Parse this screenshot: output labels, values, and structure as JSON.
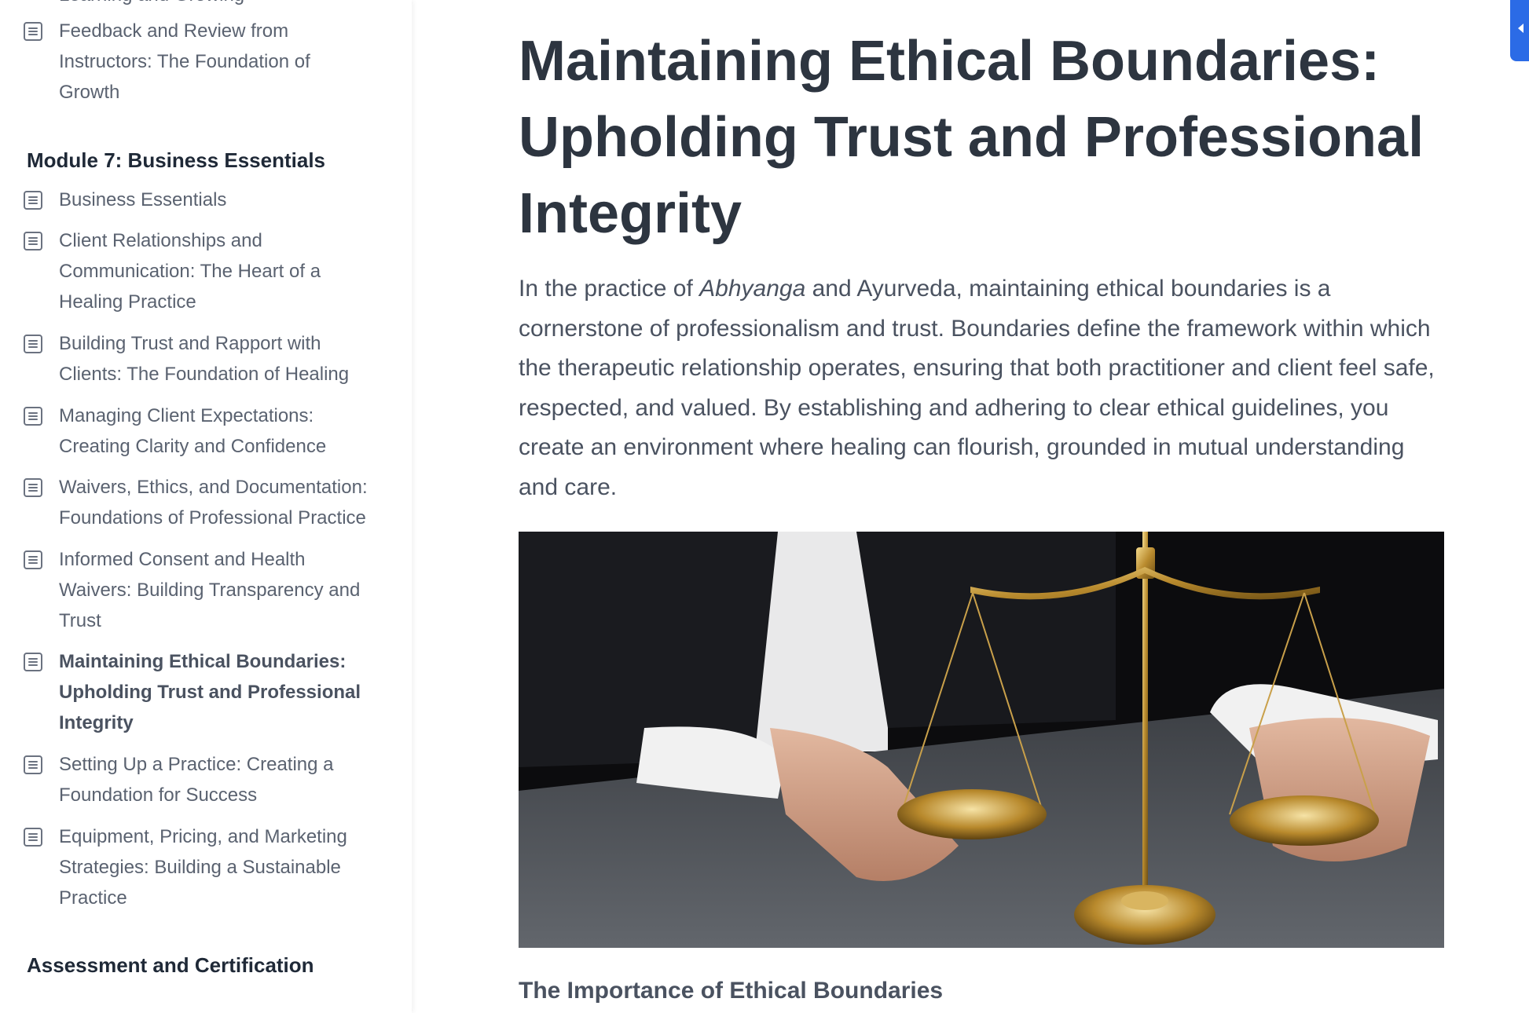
{
  "sidebar": {
    "cutoff_label": "Learning and Growing",
    "items_top": [
      {
        "label": "Feedback and Review from Instructors: The Foundation of Growth"
      }
    ],
    "module7": {
      "title": "Module 7: Business Essentials",
      "items": [
        {
          "label": "Business Essentials"
        },
        {
          "label": "Client Relationships and Communication: The Heart of a Healing Practice"
        },
        {
          "label": "Building Trust and Rapport with Clients: The Foundation of Healing"
        },
        {
          "label": "Managing Client Expectations: Creating Clarity and Confidence"
        },
        {
          "label": "Waivers, Ethics, and Documentation: Foundations of Professional Practice"
        },
        {
          "label": "Informed Consent and Health Waivers: Building Transparency and Trust"
        },
        {
          "label": "Maintaining Ethical Boundaries: Upholding Trust and Professional Integrity"
        },
        {
          "label": "Setting Up a Practice: Creating a Foundation for Success"
        },
        {
          "label": "Equipment, Pricing, and Marketing Strategies: Building a Sustainable Practice"
        }
      ]
    },
    "assessment": {
      "title": "Assessment and Certification"
    }
  },
  "main": {
    "title": "Maintaining Ethical Boundaries: Upholding Trust and Professional Integrity",
    "intro": {
      "before_em": "In the practice of ",
      "em": "Abhyanga",
      "after_em": " and Ayurveda, maintaining ethical boundaries is a cornerstone of professionalism and trust. Boundaries define the framework within which the therapeutic relationship operates, ensuring that both practitioner and client feel safe, respected, and valued. By establishing and adhering to clear ethical guidelines, you create an environment where healing can flourish, grounded in mutual understanding and care."
    },
    "section_heading": "The Importance of Ethical Boundaries"
  },
  "colors": {
    "accent": "#2b6be6",
    "title": "#2d3540",
    "body": "#4a5260"
  }
}
